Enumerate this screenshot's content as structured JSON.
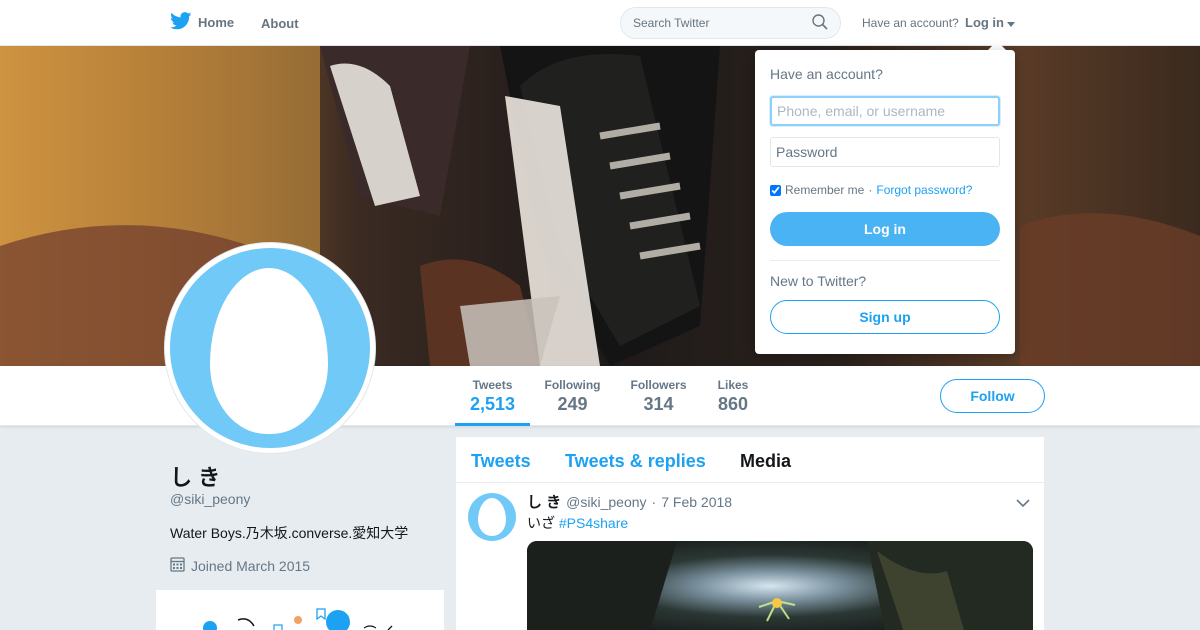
{
  "nav": {
    "home_label": "Home",
    "about_label": "About",
    "search_placeholder": "Search Twitter",
    "have_account": "Have an account?",
    "login_label": "Log in"
  },
  "profile": {
    "name": "し き",
    "handle": "@siki_peony",
    "bio": "Water Boys.乃木坂.converse.愛知大学",
    "joined": "Joined March 2015"
  },
  "stats": [
    {
      "label": "Tweets",
      "value": "2,513"
    },
    {
      "label": "Following",
      "value": "249"
    },
    {
      "label": "Followers",
      "value": "314"
    },
    {
      "label": "Likes",
      "value": "860"
    }
  ],
  "follow_label": "Follow",
  "timeline": {
    "tabs": [
      "Tweets",
      "Tweets & replies",
      "Media"
    ],
    "tweet": {
      "name": "し き",
      "handle": "@siki_peony",
      "separator": "·",
      "date": "7 Feb 2018",
      "text": "いざ",
      "hashtag": "#PS4share"
    }
  },
  "login_dropdown": {
    "heading": "Have an account?",
    "username_placeholder": "Phone, email, or username",
    "password_placeholder": "Password",
    "remember_label": "Remember me",
    "separator": "·",
    "forgot_label": "Forgot password?",
    "login_button": "Log in",
    "new_heading": "New to Twitter?",
    "signup_button": "Sign up"
  },
  "colors": {
    "accent": "#1da1f2",
    "login_button_bg": "#4ab3f4",
    "avatar_bg": "#71c9f8"
  }
}
